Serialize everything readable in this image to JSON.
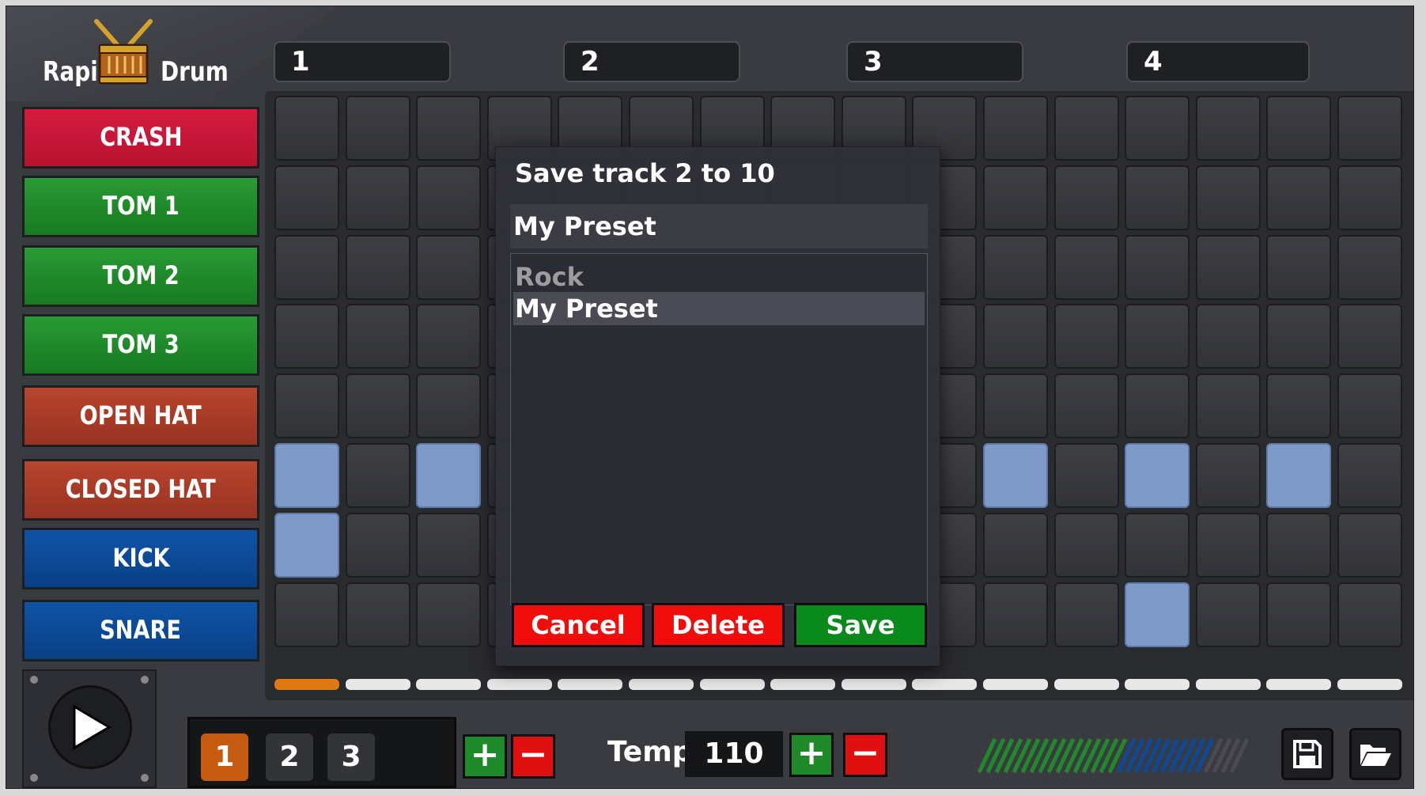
{
  "app": {
    "logo_word_1": "Rapid",
    "logo_word_2": "Drum"
  },
  "measures": [
    "1",
    "2",
    "3",
    "4"
  ],
  "instruments": [
    {
      "label": "CRASH",
      "color": "#c8173a"
    },
    {
      "label": "TOM 1",
      "color": "#1f8a2a"
    },
    {
      "label": "TOM 2",
      "color": "#1f8a2a"
    },
    {
      "label": "TOM 3",
      "color": "#1f8a2a"
    },
    {
      "label": "OPEN HAT",
      "color": "#a83b27"
    },
    {
      "label": "CLOSED HAT",
      "color": "#a83b27"
    },
    {
      "label": "KICK",
      "color": "#0c4a97"
    },
    {
      "label": "SNARE",
      "color": "#0c4a97"
    }
  ],
  "sequencer": {
    "steps": 16,
    "current_step": 1,
    "active_color": "#7d9ac8",
    "active_cells": [
      {
        "row": 6,
        "step": 1
      },
      {
        "row": 6,
        "step": 3
      },
      {
        "row": 6,
        "step": 11
      },
      {
        "row": 6,
        "step": 13
      },
      {
        "row": 6,
        "step": 15
      },
      {
        "row": 7,
        "step": 1
      },
      {
        "row": 8,
        "step": 13
      }
    ]
  },
  "tracks": {
    "items": [
      "1",
      "2",
      "3"
    ],
    "selected": "1"
  },
  "tempo": {
    "label": "Tempo",
    "value": "110",
    "plus": "+",
    "minus": "−"
  },
  "track_plus": "+",
  "track_minus": "−",
  "icons": {
    "play": "play-icon",
    "save": "floppy-disk-icon",
    "open": "folder-open-icon",
    "meter": "level-meter-icon"
  },
  "dialog": {
    "title": "Save track 2 to 10",
    "input_value": "My Preset",
    "presets": [
      "Rock",
      "My Preset"
    ],
    "selected_preset": "My Preset",
    "cancel_label": "Cancel",
    "delete_label": "Delete",
    "save_label": "Save",
    "cancel_color": "#f20d0d",
    "delete_color": "#f20d0d",
    "save_color": "#0a8a1a"
  }
}
